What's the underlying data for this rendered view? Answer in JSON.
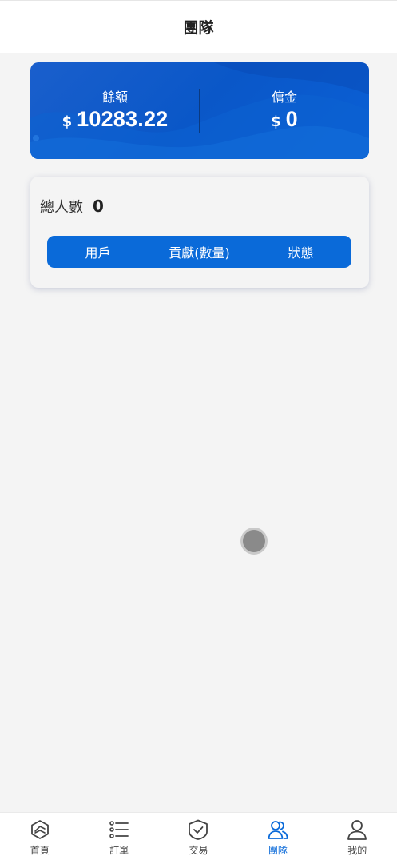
{
  "header": {
    "title": "團隊"
  },
  "balance": {
    "balance_label": "餘額",
    "balance_currency": "$",
    "balance_value": "10283.22",
    "commission_label": "傭金",
    "commission_currency": "$",
    "commission_value": "0"
  },
  "team": {
    "total_label": "總人數",
    "total_value": "0",
    "columns": [
      "用戶",
      "貢獻(數量)",
      "狀態"
    ]
  },
  "tabbar": {
    "active": "team",
    "items": [
      {
        "label": "首頁",
        "icon": "home-cube-icon"
      },
      {
        "label": "訂單",
        "icon": "list-icon"
      },
      {
        "label": "交易",
        "icon": "shield-check-icon"
      },
      {
        "label": "團隊",
        "icon": "users-icon"
      },
      {
        "label": "我的",
        "icon": "user-icon"
      }
    ]
  },
  "colors": {
    "accent": "#0a6ad9",
    "card_blue": "#0a57c8",
    "background": "#f4f4f4"
  }
}
